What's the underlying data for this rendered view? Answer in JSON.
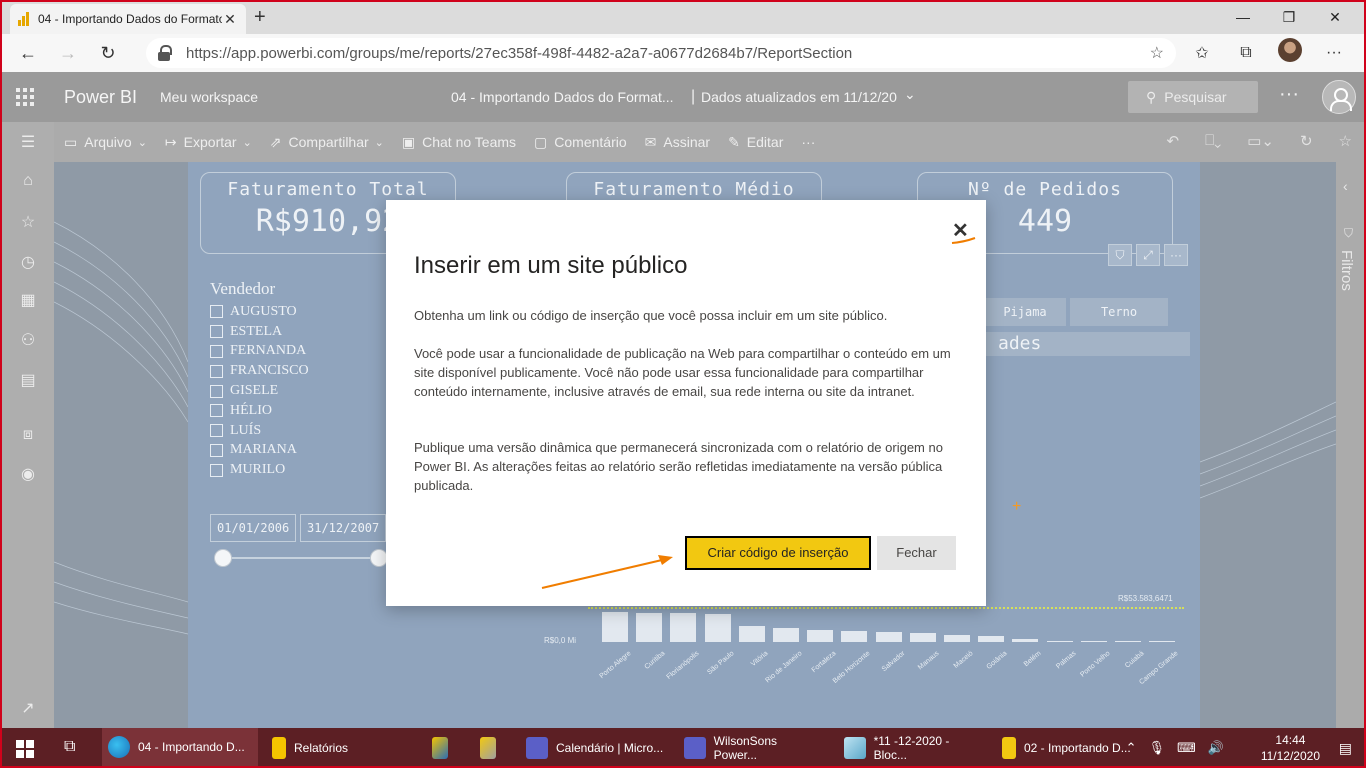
{
  "browser": {
    "tab_title": "04 - Importando Dados do Formato",
    "close_tab": "✕",
    "new_tab": "+",
    "url": "https://app.powerbi.com/groups/me/reports/27ec358f-498f-4482-a2a7-a0677d2684b7/ReportSection"
  },
  "pbi_header": {
    "brand": "Power BI",
    "workspace": "Meu workspace",
    "report_title": "04 - Importando Dados do Format...",
    "separator": "|",
    "updated": "Dados atualizados em 11/12/20",
    "search_placeholder": "Pesquisar",
    "more": "···"
  },
  "toolbar": {
    "arquivo": "Arquivo",
    "exportar": "Exportar",
    "compartilhar": "Compartilhar",
    "chat_teams": "Chat no Teams",
    "comentario": "Comentário",
    "assinar": "Assinar",
    "editar": "Editar",
    "more": "···"
  },
  "report": {
    "kpis": [
      {
        "title": "Faturamento Total",
        "value": "R$910,92"
      },
      {
        "title": "Faturamento Médio",
        "value": ""
      },
      {
        "title": "Nº de Pedidos",
        "value": "449"
      }
    ],
    "slicer_title": "Vendedor",
    "vendedores": [
      "AUGUSTO",
      "ESTELA",
      "FERNANDA",
      "FRANCISCO",
      "GISELE",
      "HÉLIO",
      "LUÍS",
      "MARIANA",
      "MURILO"
    ],
    "date_start": "01/01/2006",
    "date_end": "31/12/2007",
    "category_buttons": [
      "Pijama",
      "Terno"
    ],
    "partial_title": "ades",
    "ref_value": "R$53.583,6471",
    "axis_zero": "R$0,0 Mi"
  },
  "chart_data": {
    "type": "bar",
    "categories": [
      "Porto Alegre",
      "Curitiba",
      "Florianópolis",
      "São Paulo",
      "Vitória",
      "Rio de Janeiro",
      "Fortaleza",
      "Belo Horizonte",
      "Salvador",
      "Manaus",
      "Maceió",
      "Goiânia",
      "Belém",
      "Palmas",
      "Porto Velho",
      "Cuiabá",
      "Campo Grande"
    ],
    "values": [
      46000,
      45000,
      44000,
      43000,
      24000,
      22000,
      18000,
      17000,
      15000,
      14000,
      11000,
      9000,
      5000,
      2000,
      1000,
      800,
      500
    ],
    "reference_line": 53583.6471,
    "reference_label": "R$53.583,6471",
    "ylabel_tick": "R$0,0 Mi"
  },
  "filters": {
    "label": "Filtros"
  },
  "modal": {
    "title": "Inserir em um site público",
    "p1": "Obtenha um link ou código de inserção que você possa incluir em um site público.",
    "p2": "Você pode usar a funcionalidade de publicação na Web para compartilhar o conteúdo em um site disponível publicamente. Você não pode usar essa funcionalidade para compartilhar conteúdo internamente, inclusive através de email, sua rede interna ou site da intranet.",
    "p3": "Publique uma versão dinâmica que permanecerá sincronizada com o relatório de origem no Power BI. As alterações feitas ao relatório serão refletidas imediatamente na versão pública publicada.",
    "primary_button": "Criar código de inserção",
    "secondary_button": "Fechar",
    "close": "✕"
  },
  "taskbar": {
    "items": [
      {
        "label": "04 - Importando D..."
      },
      {
        "label": "Relatórios"
      },
      {
        "label": "Calendário | Micro..."
      },
      {
        "label": "WilsonSons Power..."
      },
      {
        "label": "*11 -12-2020 - Bloc..."
      },
      {
        "label": "02 - Importando D..."
      }
    ],
    "time": "14:44",
    "date": "11/12/2020"
  },
  "colors": {
    "accent_yellow": "#f2c811",
    "annotation_orange": "#f07d00",
    "frame_red": "#d0021b"
  }
}
